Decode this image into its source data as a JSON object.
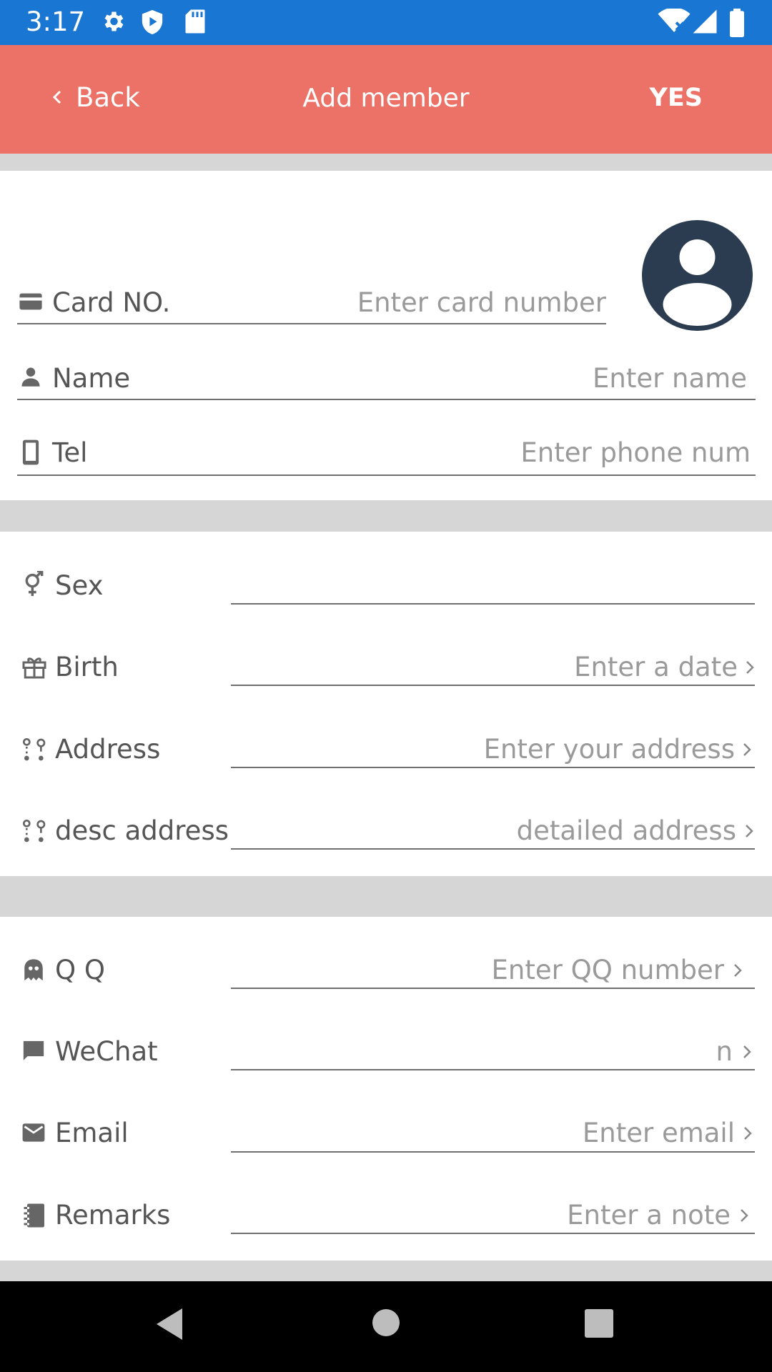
{
  "status_bar": {
    "time": "3:17"
  },
  "app_bar": {
    "back_label": "Back",
    "title": "Add member",
    "confirm_label": "YES"
  },
  "section_basic": {
    "card": {
      "label": "Card NO.",
      "placeholder": "Enter card number"
    },
    "name": {
      "label": "Name",
      "placeholder": "Enter name"
    },
    "tel": {
      "label": "Tel",
      "placeholder": "Enter phone num"
    }
  },
  "section_personal": {
    "sex": {
      "label": "Sex",
      "value": ""
    },
    "birth": {
      "label": "Birth",
      "placeholder": "Enter a date"
    },
    "address": {
      "label": "Address",
      "placeholder": "Enter your address"
    },
    "desc_address": {
      "label": "desc address",
      "placeholder": "detailed address"
    }
  },
  "section_contact": {
    "qq": {
      "label": "Q Q",
      "placeholder": "Enter QQ number"
    },
    "wechat": {
      "label": "WeChat",
      "placeholder": "n"
    },
    "email": {
      "label": "Email",
      "placeholder": "Enter email"
    },
    "remarks": {
      "label": "Remarks",
      "placeholder": "Enter a note"
    }
  },
  "colors": {
    "status_bar": "#1976d2",
    "app_bar": "#ec7166",
    "avatar": "#2b3c50",
    "section_divider": "#d6d6d6"
  },
  "icons": [
    "settings-icon",
    "shield-icon",
    "sd-card-icon",
    "wifi-icon",
    "signal-icon",
    "battery-icon",
    "credit-card-icon",
    "person-icon",
    "phone-icon",
    "gender-icon",
    "gift-icon",
    "location-icon",
    "qq-icon",
    "chat-icon",
    "mail-icon",
    "notebook-icon",
    "chevron-right-icon"
  ]
}
